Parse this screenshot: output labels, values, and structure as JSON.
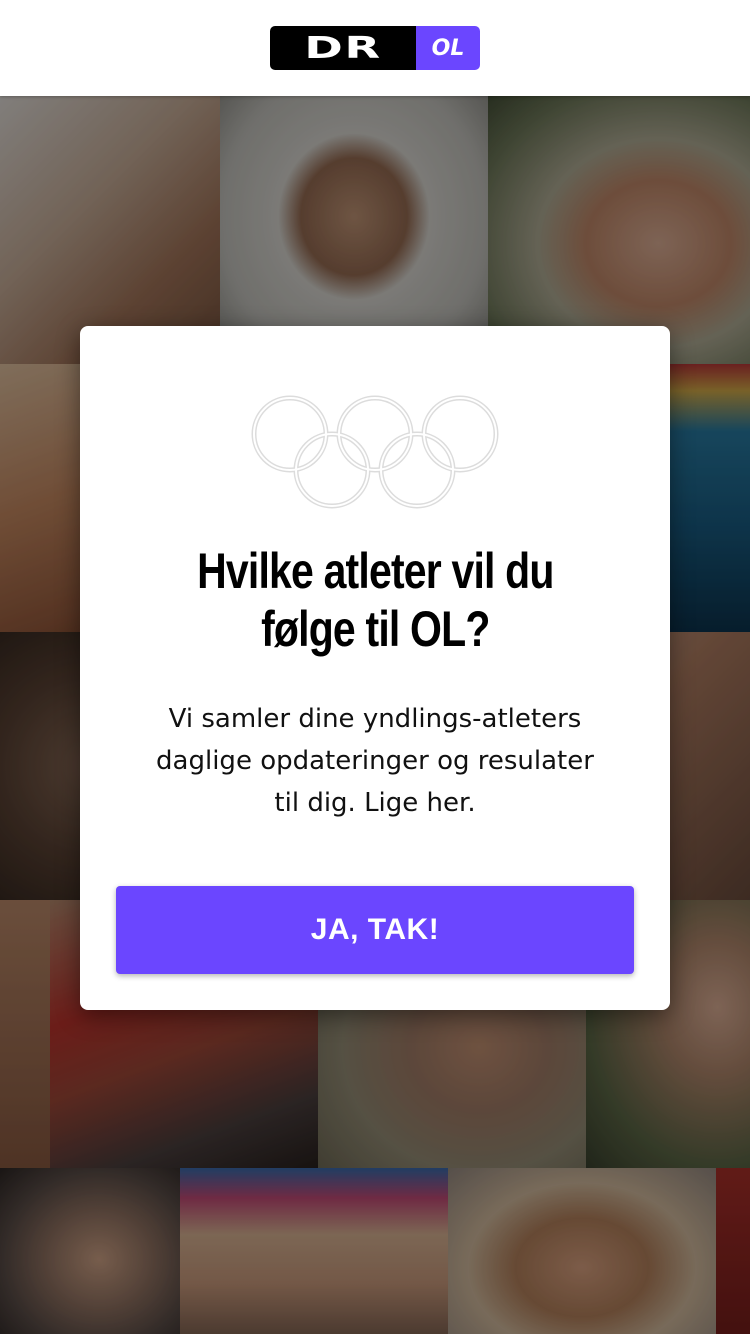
{
  "header": {
    "logo_dr": "DR",
    "logo_ol": "OL"
  },
  "dialog": {
    "title_line1": "Hvilke atleter vil du",
    "title_line2": "følge til OL?",
    "body_line1": "Vi samler dine yndlings-atleters",
    "body_line2": "daglige opdateringer og resulater",
    "body_line3": "til dig. Lige her.",
    "button_label": "JA, TAK!"
  },
  "colors": {
    "accent": "#6b46ff",
    "header_bg": "#ffffff",
    "logo_bg": "#000000",
    "ring": "#d8d8d8"
  },
  "icons": {
    "rings": "olympic-rings-icon"
  }
}
